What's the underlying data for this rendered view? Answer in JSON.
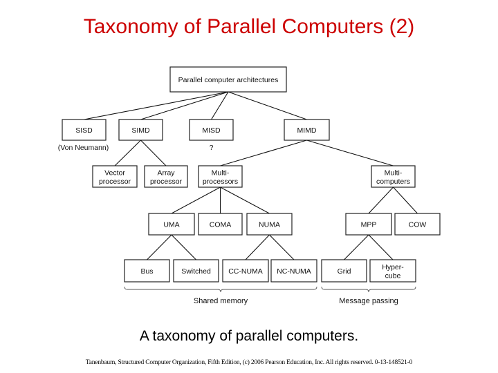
{
  "title": "Taxonomy of Parallel Computers (2)",
  "caption": "A taxonomy of parallel computers.",
  "footer": "Tanenbaum, Structured Computer Organization, Fifth Edition, (c) 2006 Pearson Education, Inc. All rights reserved. 0-13-148521-0",
  "colors": {
    "title": "#cc0000",
    "text": "#000000",
    "background": "#ffffff"
  },
  "diagram": {
    "nodes": [
      {
        "id": "root",
        "lines": [
          "Parallel computer architectures"
        ]
      },
      {
        "id": "sisd",
        "lines": [
          "SISD"
        ]
      },
      {
        "id": "simd",
        "lines": [
          "SIMD"
        ]
      },
      {
        "id": "misd",
        "lines": [
          "MISD"
        ]
      },
      {
        "id": "mimd",
        "lines": [
          "MIMD"
        ]
      },
      {
        "id": "vector",
        "lines": [
          "Vector",
          "processor"
        ]
      },
      {
        "id": "array",
        "lines": [
          "Array",
          "processor"
        ]
      },
      {
        "id": "multiproc",
        "lines": [
          "Multi-",
          "processors"
        ]
      },
      {
        "id": "multicomp",
        "lines": [
          "Multi-",
          "computers"
        ]
      },
      {
        "id": "uma",
        "lines": [
          "UMA"
        ]
      },
      {
        "id": "coma",
        "lines": [
          "COMA"
        ]
      },
      {
        "id": "numa",
        "lines": [
          "NUMA"
        ]
      },
      {
        "id": "mpp",
        "lines": [
          "MPP"
        ]
      },
      {
        "id": "cow",
        "lines": [
          "COW"
        ]
      },
      {
        "id": "bus",
        "lines": [
          "Bus"
        ]
      },
      {
        "id": "switched",
        "lines": [
          "Switched"
        ]
      },
      {
        "id": "ccnuma",
        "lines": [
          "CC-NUMA"
        ]
      },
      {
        "id": "ncnuma",
        "lines": [
          "NC-NUMA"
        ]
      },
      {
        "id": "grid",
        "lines": [
          "Grid"
        ]
      },
      {
        "id": "hypercube",
        "lines": [
          "Hyper-",
          "cube"
        ]
      }
    ],
    "edges": [
      [
        "root",
        "sisd"
      ],
      [
        "root",
        "simd"
      ],
      [
        "root",
        "misd"
      ],
      [
        "root",
        "mimd"
      ],
      [
        "simd",
        "vector"
      ],
      [
        "simd",
        "array"
      ],
      [
        "mimd",
        "multiproc"
      ],
      [
        "mimd",
        "multicomp"
      ],
      [
        "multiproc",
        "uma"
      ],
      [
        "multiproc",
        "coma"
      ],
      [
        "multiproc",
        "numa"
      ],
      [
        "multicomp",
        "mpp"
      ],
      [
        "multicomp",
        "cow"
      ],
      [
        "uma",
        "bus"
      ],
      [
        "uma",
        "switched"
      ],
      [
        "numa",
        "ccnuma"
      ],
      [
        "numa",
        "ncnuma"
      ],
      [
        "mpp",
        "grid"
      ],
      [
        "mpp",
        "hypercube"
      ]
    ],
    "notes": [
      {
        "under": "sisd",
        "text": "(Von Neumann)"
      },
      {
        "under": "misd",
        "text": "?"
      }
    ],
    "groups": [
      {
        "id": "shared",
        "label": "Shared memory",
        "from": "bus",
        "to": "ncnuma"
      },
      {
        "id": "message",
        "label": "Message passing",
        "from": "grid",
        "to": "hypercube"
      }
    ]
  }
}
